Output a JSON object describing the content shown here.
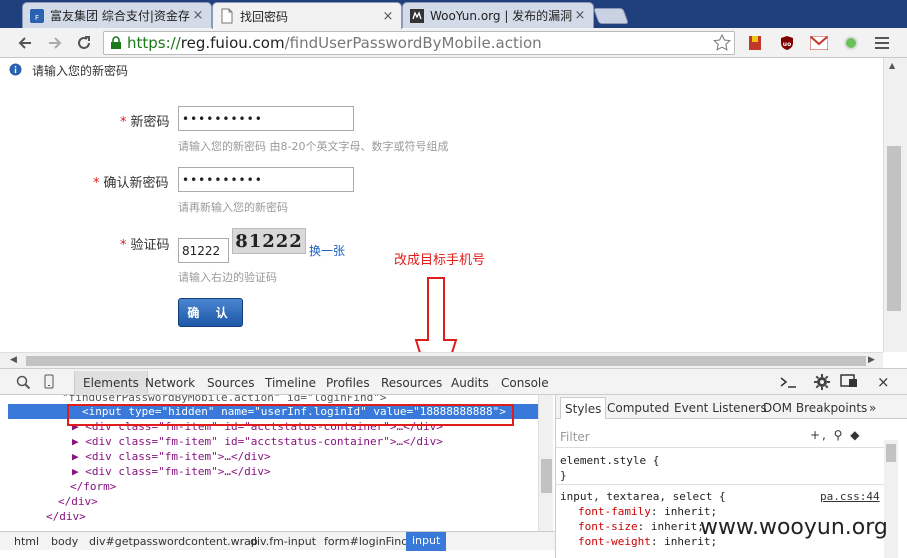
{
  "browser": {
    "tabs": [
      {
        "title": "富友集团 综合支付|资金存",
        "favicon": "fuiou-logo-icon"
      },
      {
        "title": "找回密码",
        "favicon": "page-icon",
        "active": true
      },
      {
        "title": "WooYun.org | 发布的漏洞",
        "favicon": "wooyun-logo-icon"
      }
    ],
    "tab_close": "×",
    "url": {
      "scheme": "https://",
      "host": "reg.fuiou.com",
      "path": "/findUserPasswordByMobile.action"
    },
    "extensions": [
      "bookmark-red-icon",
      "ublock-icon",
      "gmail-icon",
      "green-dot-icon"
    ]
  },
  "page": {
    "header_text": "请输入您的新密码",
    "new_password": {
      "label": "新密码",
      "value": "••••••••••",
      "hint": "请输入您的新密码 由8-20个英文字母、数字或符号组成"
    },
    "confirm_password": {
      "label": "确认新密码",
      "value": "••••••••••",
      "hint": "请再新输入您的新密码"
    },
    "captcha": {
      "label": "验证码",
      "value": "81222",
      "image_text": "81222",
      "refresh_link": "换一张",
      "hint": "请输入右边的验证码"
    },
    "required_mark": "*",
    "submit_label": "确 认",
    "annotation": "改成目标手机号"
  },
  "devtools": {
    "tabs": [
      "Elements",
      "Network",
      "Sources",
      "Timeline",
      "Profiles",
      "Resources",
      "Audits",
      "Console"
    ],
    "active_tab": "Elements",
    "dom_lines": [
      {
        "text": "\"findUserPasswordByMobile.action\" id=\"loginFind\">"
      },
      {
        "text": "<input type=\"hidden\" name=\"userInf.loginId\" value=\"18888888888\">",
        "selected": true
      },
      {
        "text": "▶ <div class=\"fm-item\" id=\"acctstatus-container\">…</div>"
      },
      {
        "text": "▶ <div class=\"fm-item\" id=\"acctstatus-container\">…</div>"
      },
      {
        "text": "▶ <div class=\"fm-item\">…</div>"
      },
      {
        "text": "▶ <div class=\"fm-item\">…</div>"
      },
      {
        "text": "</form>"
      },
      {
        "text": "</div>"
      },
      {
        "text": "</div>"
      }
    ],
    "breadcrumbs": [
      "html",
      "body",
      "div#getpasswordcontent.wrap",
      "div.fm-input",
      "form#loginFind",
      "input"
    ],
    "styles_tabs": [
      "Styles",
      "Computed",
      "Event Listeners",
      "DOM Breakpoints"
    ],
    "styles_more": "»",
    "filter_placeholder": "Filter",
    "filter_tools": "+, ⚲ ◆",
    "css": {
      "element_style": "element.style {",
      "element_close": "}",
      "rule_selector": "input, textarea, select {",
      "rule_source": "pa.css:44",
      "props": [
        {
          "name": "font-family",
          "value": "inherit;"
        },
        {
          "name": "font-size",
          "value": "inherit;"
        },
        {
          "name": "font-weight",
          "value": "inherit;"
        }
      ]
    }
  },
  "watermark": "www.wooyun.org"
}
